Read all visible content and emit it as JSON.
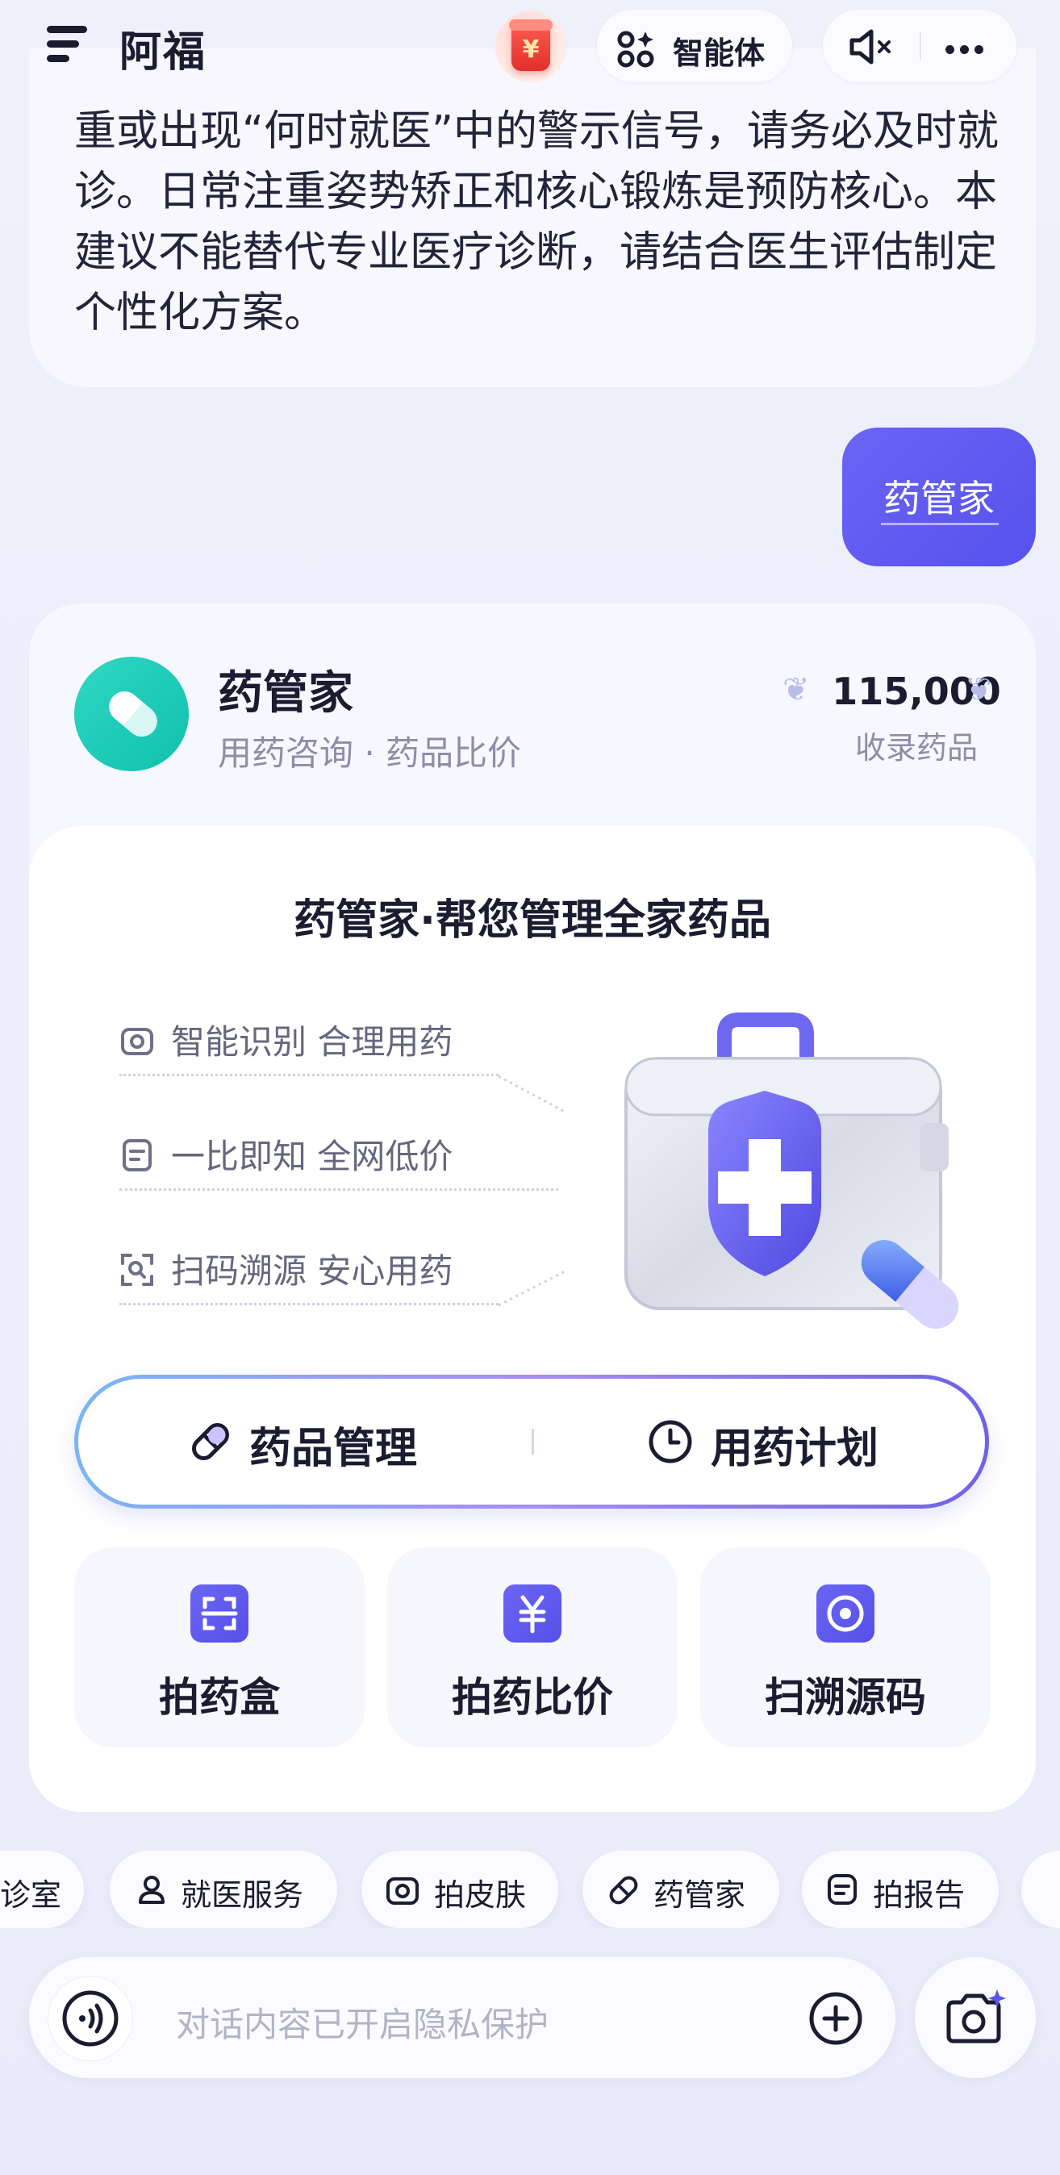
{
  "header": {
    "app_title": "阿福",
    "agent_label": "智能体",
    "redpacket_symbol": "¥"
  },
  "previous_message": {
    "text": "重或出现“何时就医”中的警示信号，请务必及时就诊。日常注重姿势矫正和核心锻炼是预防核心。本建议不能替代专业医疗诊断，请结合医生评估制定个性化方案。"
  },
  "user_message": {
    "text": "药管家"
  },
  "card": {
    "title": "药管家",
    "subtitle": "用药咨询 · 药品比价",
    "stat_value": "115,000",
    "stat_label": "收录药品",
    "inner_title": "药管家·帮您管理全家药品",
    "features": [
      {
        "icon": "camera-icon",
        "text": "智能识别 合理用药"
      },
      {
        "icon": "document-icon",
        "text": "一比即知 全网低价"
      },
      {
        "icon": "scan-icon",
        "text": "扫码溯源 安心用药"
      }
    ],
    "main_actions": [
      {
        "icon": "pill-icon",
        "label": "药品管理"
      },
      {
        "icon": "clock-icon",
        "label": "用药计划"
      }
    ],
    "tiles": [
      {
        "icon": "scan-box-icon",
        "label": "拍药盒"
      },
      {
        "icon": "yen-icon",
        "label": "拍药比价"
      },
      {
        "icon": "target-icon",
        "label": "扫溯源码"
      }
    ]
  },
  "quick_chips": [
    {
      "label": "诊室"
    },
    {
      "icon": "person-icon",
      "label": "就医服务"
    },
    {
      "icon": "camera-icon",
      "label": "拍皮肤"
    },
    {
      "icon": "pill-icon",
      "label": "药管家"
    },
    {
      "icon": "document-icon",
      "label": "拍报告"
    }
  ],
  "input": {
    "placeholder": "对话内容已开启隐私保护"
  },
  "colors": {
    "accent": "#5a54ee",
    "teal": "#16c6b3",
    "text": "#1b1c30",
    "muted": "#8d8ea6"
  }
}
